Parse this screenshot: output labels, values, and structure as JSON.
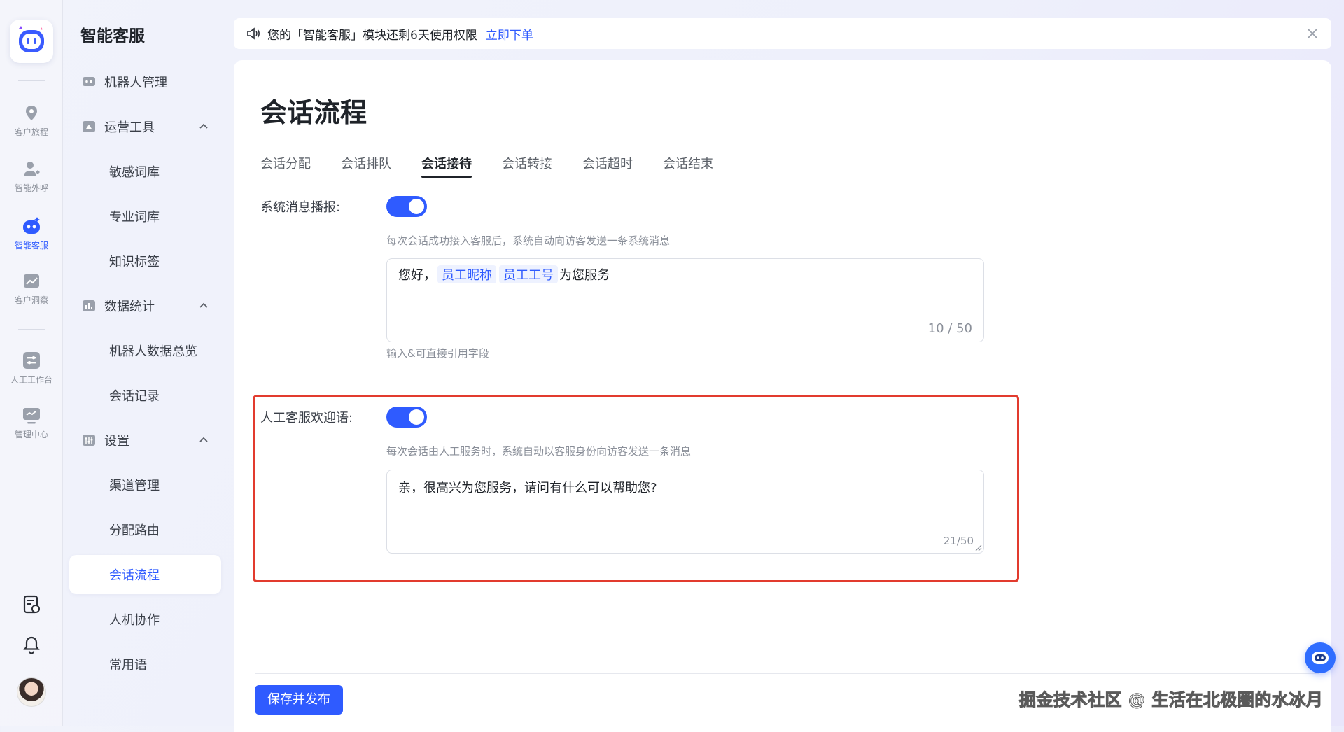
{
  "rail": {
    "items": [
      {
        "label": "客户旅程",
        "icon": "map-pin-icon"
      },
      {
        "label": "智能外呼",
        "icon": "user-call-icon"
      },
      {
        "label": "智能客服",
        "icon": "robot-icon",
        "active": true
      },
      {
        "label": "客户洞察",
        "icon": "insight-chart-icon"
      },
      {
        "label": "人工工作台",
        "icon": "workbench-icon"
      },
      {
        "label": "管理中心",
        "icon": "monitor-icon"
      }
    ]
  },
  "menu": {
    "title": "智能客服",
    "items": [
      {
        "label": "机器人管理",
        "icon": "robot-manage-icon"
      },
      {
        "label": "运营工具",
        "icon": "tools-icon",
        "expanded": true
      },
      {
        "label": "敏感词库"
      },
      {
        "label": "专业词库"
      },
      {
        "label": "知识标签"
      },
      {
        "label": "数据统计",
        "icon": "stats-icon",
        "expanded": true
      },
      {
        "label": "机器人数据总览"
      },
      {
        "label": "会话记录"
      },
      {
        "label": "设置",
        "icon": "settings-icon",
        "expanded": true
      },
      {
        "label": "渠道管理"
      },
      {
        "label": "分配路由"
      },
      {
        "label": "会话流程",
        "active": true
      },
      {
        "label": "人机协作"
      },
      {
        "label": "常用语"
      }
    ]
  },
  "notice": {
    "text": "您的「智能客服」模块还剩6天使用权限",
    "link": "立即下单"
  },
  "page": {
    "title": "会话流程",
    "tabs": [
      "会话分配",
      "会话排队",
      "会话接待",
      "会话转接",
      "会话超时",
      "会话结束"
    ],
    "active_tab": "会话接待"
  },
  "system_message": {
    "label": "系统消息播报:",
    "enabled": true,
    "hint": "每次会话成功接入客服后，系统自动向访客发送一条系统消息",
    "text_prefix": "您好，",
    "chip_1": "员工昵称",
    "chip_2": "员工工号",
    "text_suffix": "为您服务",
    "counter": "10 / 50",
    "helper": "输入&可直接引用字段"
  },
  "welcome_message": {
    "label": "人工客服欢迎语:",
    "enabled": true,
    "hint": "每次会话由人工服务时，系统自动以客服身份向访客发送一条消息",
    "text": "亲，很高兴为您服务，请问有什么可以帮助您?",
    "counter": "21/50"
  },
  "footer": {
    "save_label": "保存并发布"
  },
  "watermark": "掘金技术社区 @ 生活在北极圈的水冰月",
  "colors": {
    "primary": "#2f5bff",
    "highlight_border": "#e23b2e",
    "muted_text": "#8a8f99"
  }
}
